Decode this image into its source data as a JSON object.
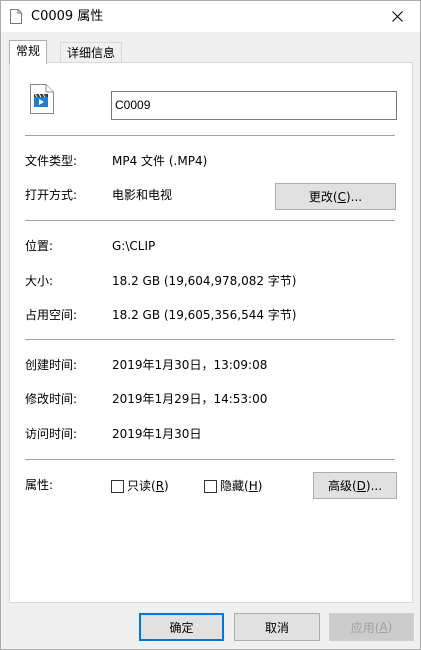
{
  "window": {
    "title": "C0009 属性"
  },
  "tabs": [
    {
      "label": "常规",
      "active": true
    },
    {
      "label": "详细信息",
      "active": false
    }
  ],
  "general": {
    "file_name": "C0009",
    "type_label": "文件类型:",
    "type_value": "MP4 文件 (.MP4)",
    "open_with_label": "打开方式:",
    "open_with_value": "电影和电视",
    "change_button": {
      "prefix": "更改(",
      "key": "C",
      "suffix": ")..."
    },
    "location_label": "位置:",
    "location_value": "G:\\CLIP",
    "size_label": "大小:",
    "size_value": "18.2 GB (19,604,978,082 字节)",
    "size_on_disk_label": "占用空间:",
    "size_on_disk_value": "18.2 GB (19,605,356,544 字节)",
    "created_label": "创建时间:",
    "created_value": "2019年1月30日，13:09:08",
    "modified_label": "修改时间:",
    "modified_value": "2019年1月29日，14:53:00",
    "accessed_label": "访问时间:",
    "accessed_value": "2019年1月30日",
    "attributes_label": "属性:",
    "readonly": {
      "prefix": "只读(",
      "key": "R",
      "suffix": ")",
      "checked": false
    },
    "hidden": {
      "prefix": "隐藏(",
      "key": "H",
      "suffix": ")",
      "checked": false
    },
    "advanced_button": {
      "prefix": "高级(",
      "key": "D",
      "suffix": ")..."
    }
  },
  "footer": {
    "ok_label": "确定",
    "cancel_label": "取消",
    "apply": {
      "prefix": "应用(",
      "key": "A",
      "suffix": ")"
    }
  },
  "colors": {
    "accent": "#0078d7",
    "icon_blue": "#1e7fd6"
  }
}
